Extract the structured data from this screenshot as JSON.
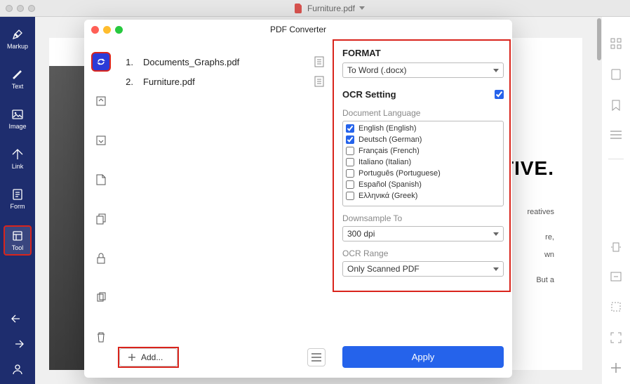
{
  "titlebar": {
    "filename": "Furniture.pdf"
  },
  "sidebar": {
    "items": [
      {
        "label": "Markup"
      },
      {
        "label": "Text"
      },
      {
        "label": "Image"
      },
      {
        "label": "Link"
      },
      {
        "label": "Form"
      },
      {
        "label": "Tool"
      }
    ]
  },
  "document": {
    "heading_suffix": "TIVE.",
    "body1_suffix": "reatives",
    "body2_l1": "re,",
    "body2_l2": "wn",
    "body3_suffix": "But a"
  },
  "modal": {
    "title": "PDF Converter",
    "files": [
      {
        "num": "1.",
        "name": "Documents_Graphs.pdf"
      },
      {
        "num": "2.",
        "name": "Furniture.pdf"
      }
    ],
    "add_label": "Add...",
    "format": {
      "heading": "FORMAT",
      "selected": "To Word (.docx)"
    },
    "ocr": {
      "heading": "OCR Setting",
      "enabled": true,
      "lang_label": "Document Language",
      "languages": [
        {
          "label": "English (English)",
          "checked": true
        },
        {
          "label": "Deutsch (German)",
          "checked": true
        },
        {
          "label": "Français (French)",
          "checked": false
        },
        {
          "label": "Italiano (Italian)",
          "checked": false
        },
        {
          "label": "Português (Portuguese)",
          "checked": false
        },
        {
          "label": "Español (Spanish)",
          "checked": false
        },
        {
          "label": "Ελληνικά (Greek)",
          "checked": false
        }
      ],
      "downsample_label": "Downsample To",
      "downsample_value": "300 dpi",
      "range_label": "OCR Range",
      "range_value": "Only Scanned PDF"
    },
    "apply_label": "Apply"
  }
}
